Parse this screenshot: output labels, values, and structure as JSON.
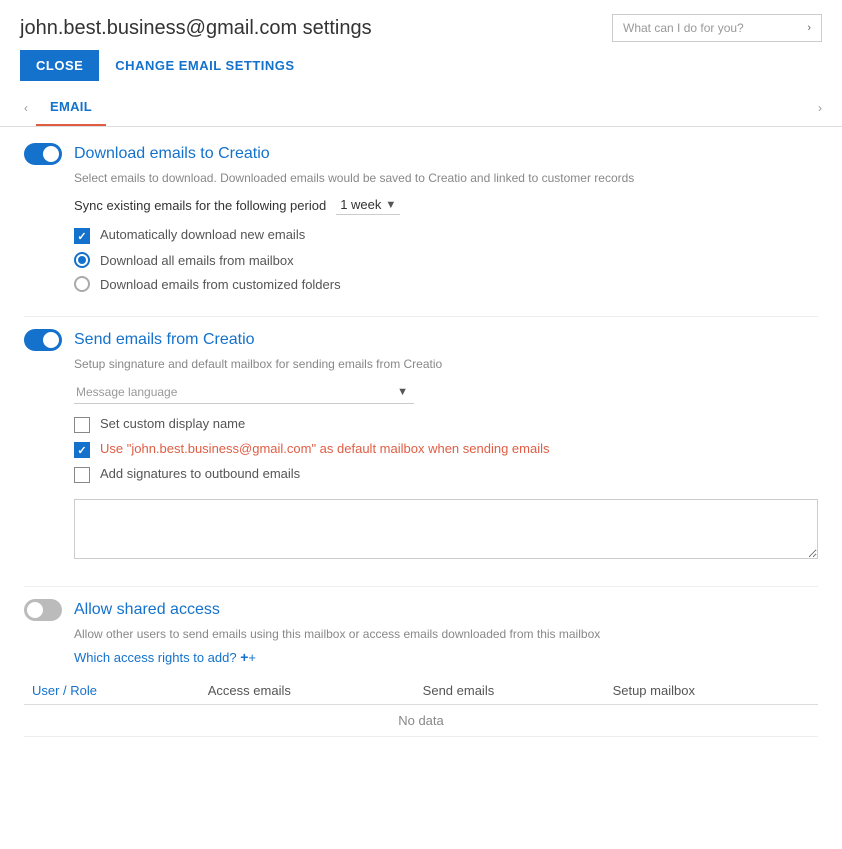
{
  "header": {
    "title": "john.best.business@gmail.com settings",
    "search_placeholder": "What can I do for you?",
    "search_chevron": "›"
  },
  "toolbar": {
    "close_label": "CLOSE",
    "change_email_label": "CHANGE EMAIL SETTINGS"
  },
  "tabs": {
    "left_chevron": "‹",
    "right_chevron": "›",
    "active_tab": "EMAIL"
  },
  "sections": {
    "download": {
      "title": "Download emails to Creatio",
      "toggle_state": "on",
      "description": "Select emails to download. Downloaded emails would be saved to Creatio and linked to customer records",
      "sync_period_label": "Sync existing emails for the following period",
      "sync_period_value": "1 week",
      "auto_download_label": "Automatically download new emails",
      "auto_download_checked": true,
      "radio_options": [
        {
          "label": "Download all emails from mailbox",
          "selected": true
        },
        {
          "label": "Download emails from customized folders",
          "selected": false
        }
      ]
    },
    "send": {
      "title": "Send emails from Creatio",
      "toggle_state": "on",
      "description": "Setup singnature and default mailbox for sending emails from Creatio",
      "message_language_placeholder": "Message language",
      "checkboxes": [
        {
          "label": "Set custom display name",
          "checked": false,
          "highlight": false
        },
        {
          "label": "Use \"john.best.business@gmail.com\" as default mailbox when sending emails",
          "checked": true,
          "highlight": true
        },
        {
          "label": "Add signatures to outbound emails",
          "checked": false,
          "highlight": false
        }
      ],
      "signature_placeholder": ""
    },
    "shared": {
      "title": "Allow shared access",
      "toggle_state": "off",
      "description": "Allow other users to send emails using this mailbox or access emails downloaded from this mailbox",
      "add_access_text": "Which access rights to add?",
      "add_access_plus": "+",
      "table": {
        "columns": [
          "User / Role",
          "Access emails",
          "Send emails",
          "Setup mailbox"
        ],
        "no_data_text": "No data"
      }
    }
  }
}
